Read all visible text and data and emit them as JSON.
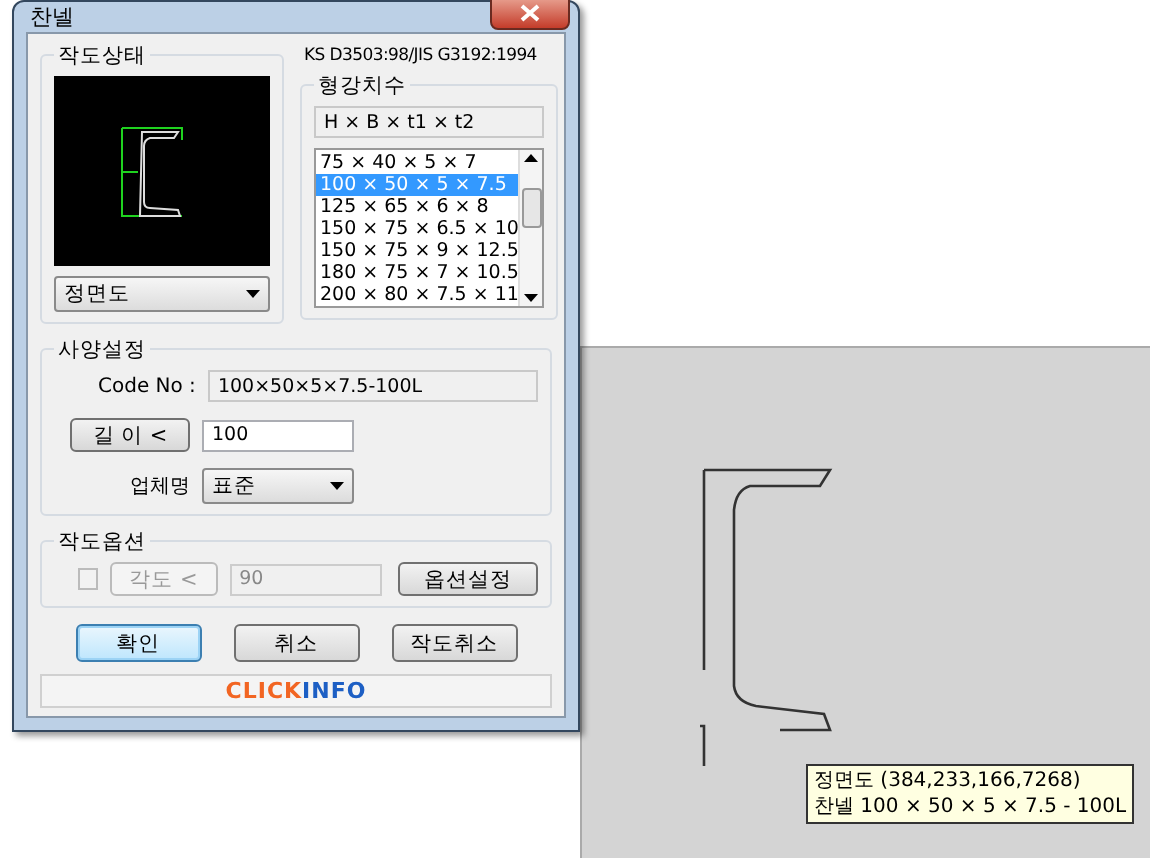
{
  "window": {
    "title": "찬넬"
  },
  "drawing_state": {
    "label": "작도상태",
    "view": "정면도"
  },
  "standard": "KS D3503:98/JIS G3192:1994",
  "sizes": {
    "label": "형강치수",
    "header": "H × B × t1 × t2",
    "items": [
      {
        "label": "75 × 40 × 5 × 7",
        "selected": false
      },
      {
        "label": "100 × 50 × 5 × 7.5",
        "selected": true
      },
      {
        "label": "125 × 65 × 6 × 8",
        "selected": false
      },
      {
        "label": "150 × 75 × 6.5 × 10",
        "selected": false
      },
      {
        "label": "150 × 75 × 9 × 12.5",
        "selected": false
      },
      {
        "label": "180 × 75 × 7 × 10.5",
        "selected": false
      },
      {
        "label": "200 × 80 × 7.5 × 11",
        "selected": false
      }
    ]
  },
  "spec": {
    "label": "사양설정",
    "code_label": "Code No :",
    "code_value": "100×50×5×7.5-100L",
    "length_button": "길 이 <",
    "length_value": "100",
    "maker_label": "업체명",
    "maker_value": "표준"
  },
  "options": {
    "label": "작도옵션",
    "checked": false,
    "disabled": true,
    "angle_button": "각도 <",
    "angle_value": "90",
    "settings_button": "옵션설정"
  },
  "buttons": [
    {
      "label": "확인",
      "default": true
    },
    {
      "label": "취소",
      "default": false
    },
    {
      "label": "작도취소",
      "default": false
    }
  ],
  "brand": [
    {
      "text": "CLICK",
      "color": "#f26522"
    },
    {
      "text": "INFO",
      "color": "#1d5fc4"
    }
  ],
  "canvas": {
    "tooltip": [
      "정면도 (384,233,166,7268)",
      "찬넬  100 × 50 × 5 × 7.5 - 100L"
    ]
  }
}
